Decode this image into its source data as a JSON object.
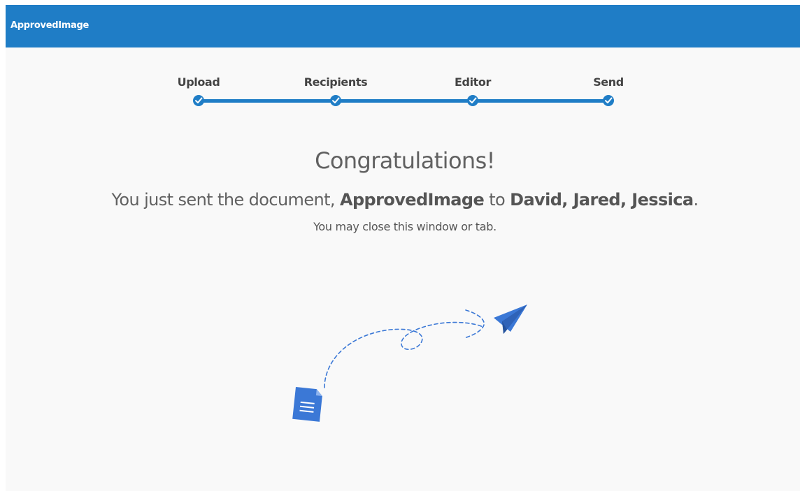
{
  "app": {
    "brand": "ApprovedImage"
  },
  "steps": [
    {
      "label": "Upload",
      "completed": true
    },
    {
      "label": "Recipients",
      "completed": true
    },
    {
      "label": "Editor",
      "completed": true
    },
    {
      "label": "Send",
      "completed": true
    }
  ],
  "content": {
    "headline": "Congratulations!",
    "message_prefix": "You just sent the document,",
    "document_name": "ApprovedImage",
    "message_to": "to",
    "recipients": "David, Jared, Jessica",
    "message_suffix": ".",
    "subnote": "You may close this window or tab."
  },
  "colors": {
    "brand_blue": "#1f7dc6",
    "illustration_blue": "#3b78d6",
    "text_gray": "#616161",
    "background": "#f9f9f9"
  },
  "icons": {
    "step": "check-circle-icon",
    "document": "document-icon",
    "plane": "paper-plane-icon"
  }
}
